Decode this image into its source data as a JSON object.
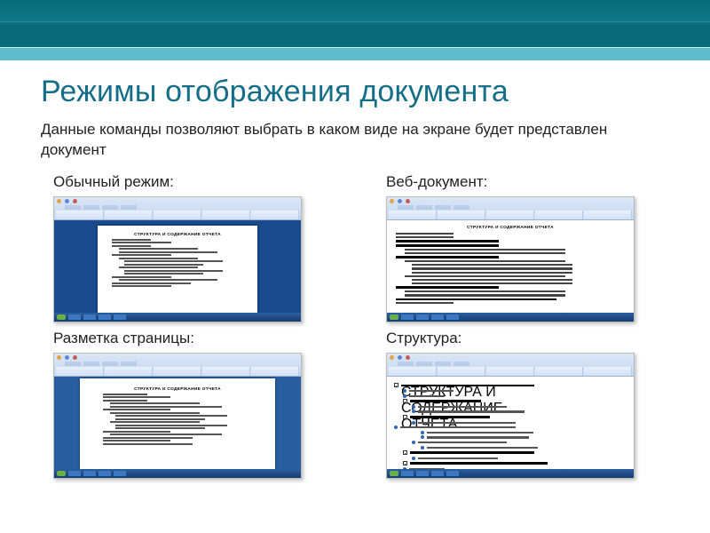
{
  "slide": {
    "title": "Режимы отображения документа",
    "subtitle": "Данные команды позволяют выбрать в каком виде на экране будет представлен документ"
  },
  "views": [
    {
      "label": "Обычный режим:",
      "doc_heading": "СТРУКТУРА И СОДЕРЖАНИЕ ОТЧЕТА"
    },
    {
      "label": "Веб-документ:",
      "doc_heading": "СТРУКТУРА И СОДЕРЖАНИЕ ОТЧЕТА"
    },
    {
      "label": "Разметка страницы:",
      "doc_heading": "СТРУКТУРА И СОДЕРЖАНИЕ ОТЧЕТА"
    },
    {
      "label": "Структура:",
      "doc_heading": "СТРУКТУРА И СОДЕРЖАНИЕ ОТЧЕТА"
    }
  ],
  "colors": {
    "banner": "#0a6b78",
    "accent_line": "#5fbccd",
    "title": "#156e88"
  }
}
